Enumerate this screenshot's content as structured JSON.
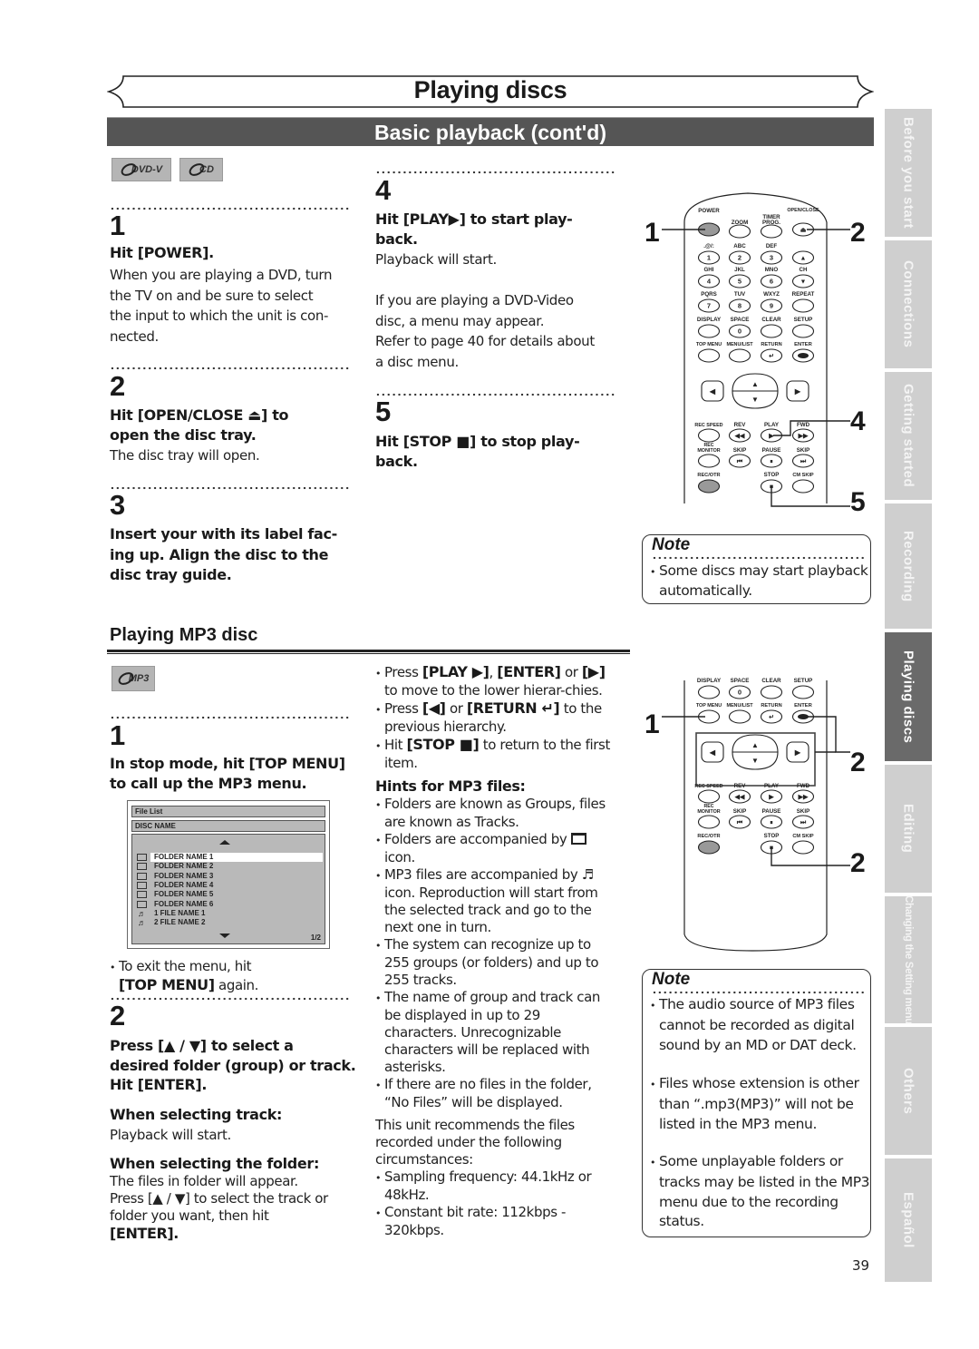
{
  "header": {
    "title": "Playing discs",
    "section": "Basic playback (cont'd)"
  },
  "side_tabs": [
    {
      "label": "Before you start",
      "active": false
    },
    {
      "label": "Connections",
      "active": false
    },
    {
      "label": "Getting started",
      "active": false
    },
    {
      "label": "Recording",
      "active": false
    },
    {
      "label": "Playing discs",
      "active": true
    },
    {
      "label": "Editing",
      "active": false
    },
    {
      "label": "Changing the Setting menu",
      "active": false
    },
    {
      "label": "Others",
      "active": false
    },
    {
      "label": "Español",
      "active": false
    }
  ],
  "badges": {
    "dvd": "DVD-V",
    "cd": "CD",
    "mp3": "MP3"
  },
  "basic": {
    "steps": [
      {
        "num": "1",
        "heading": "Hit [POWER].",
        "body": [
          "When you are playing a DVD, turn",
          "the TV on and be sure to select",
          "the input to which the unit is con-",
          "nected."
        ]
      },
      {
        "num": "2",
        "heading": [
          "Hit [OPEN/CLOSE ⏏] to",
          "open the disc tray."
        ],
        "body": [
          "The disc tray will open."
        ]
      },
      {
        "num": "3",
        "heading": [
          "Insert your with its label fac-",
          "ing up. Align the disc to the",
          "disc tray guide."
        ]
      },
      {
        "num": "4",
        "heading": [
          "Hit [PLAY▶] to start play-",
          "back."
        ],
        "body": [
          "Playback will start.",
          "",
          "If you are playing a DVD-Video",
          "disc, a menu may appear.",
          "Refer to page 40 for details about",
          "a disc menu."
        ]
      },
      {
        "num": "5",
        "heading": [
          "Hit [STOP ■] to stop play-",
          "back."
        ]
      }
    ],
    "note": {
      "title": "Note",
      "items": [
        "Some discs may start playback automatically."
      ]
    },
    "callouts": [
      "1",
      "2",
      "4",
      "5"
    ]
  },
  "mp3": {
    "title": "Playing MP3 disc",
    "step1": {
      "num": "1",
      "heading": [
        "In stop mode, hit [TOP MENU]",
        "to call up the MP3 menu."
      ],
      "exit_text": "To exit the menu, hit",
      "exit_bold": "[TOP MENU]",
      "exit_tail": " again."
    },
    "screen": {
      "header1": "File List",
      "header2": "DISC NAME",
      "items": [
        {
          "type": "folder",
          "label": "FOLDER NAME 1",
          "selected": true
        },
        {
          "type": "folder",
          "label": "FOLDER NAME 2",
          "selected": false
        },
        {
          "type": "folder",
          "label": "FOLDER NAME 3",
          "selected": false
        },
        {
          "type": "folder",
          "label": "FOLDER NAME 4",
          "selected": false
        },
        {
          "type": "folder",
          "label": "FOLDER NAME 5",
          "selected": false
        },
        {
          "type": "folder",
          "label": "FOLDER NAME 6",
          "selected": false
        },
        {
          "type": "file",
          "label": "1 FILE NAME 1",
          "selected": false
        },
        {
          "type": "file",
          "label": "2 FILE NAME 2",
          "selected": false
        }
      ],
      "page": "1/2"
    },
    "step2": {
      "num": "2",
      "heading": [
        "Press [▲ / ▼] to select a",
        "desired folder (group) or track.",
        "Hit [ENTER]."
      ],
      "track_heading": "When selecting track:",
      "track_body": "Playback will start.",
      "folder_heading": "When selecting the folder:",
      "folder_body": [
        "The files in folder will appear.",
        "Press [▲ / ▼] to select the track or",
        "folder you want, then hit"
      ],
      "folder_enter": "[ENTER]."
    },
    "middle": {
      "bullets_top": [
        {
          "html_parts": [
            "Press ",
            "[PLAY ▶]",
            ", ",
            "[ENTER]",
            " or ",
            "[▶]",
            " to move to the lower hierar-chies."
          ]
        },
        {
          "html_parts": [
            "Press ",
            "[◀]",
            " or ",
            "[RETURN ↵]",
            " to the previous hierarchy."
          ]
        },
        {
          "html_parts": [
            "Hit ",
            "[STOP ■]",
            " to return to the first item."
          ]
        }
      ],
      "hints_title": "Hints for MP3 files:",
      "hints": [
        "Folders are known as Groups, files are known as Tracks.",
        "Folders are accompanied by [folder] icon.",
        "MP3 files are accompanied by ♬ icon. Reproduction will start from the selected track and go to the next one in turn.",
        "The system can recognize up to 255 groups (or folders) and up to 255 tracks.",
        "The name of group and track can be displayed in up to 29 characters. Unrecognizable characters will be replaced with asterisks.",
        "If there are no files in the folder, “No Files” will be displayed."
      ],
      "recommend": "This unit recommends the files recorded under the following circumstances:",
      "specs": [
        "Sampling frequency: 44.1kHz or 48kHz.",
        "Constant bit rate: 112kbps - 320kbps."
      ]
    },
    "note": {
      "title": "Note",
      "items": [
        "The audio source of MP3 files cannot be recorded as digital sound by an MD or DAT deck.",
        "Files whose extension is other than “.mp3(MP3)” will not be listed in the MP3 menu.",
        "Some unplayable folders or tracks may be listed in the MP3 menu due to the recording status."
      ]
    },
    "callouts": [
      "1",
      "2",
      "2"
    ]
  },
  "remote_labels": {
    "power": "POWER",
    "zoom": "ZOOM",
    "timer": "TIMER",
    "prog": "PROG.",
    "openclose": "OPEN/CLOSE",
    "k1": ".@/:",
    "k2": "ABC",
    "k3": "DEF",
    "ghi": "GHI",
    "jkl": "JKL",
    "mno": "MNO",
    "ch": "CH",
    "pqrs": "PQRS",
    "tuv": "TUV",
    "wxyz": "WXYZ",
    "repeat": "REPEAT",
    "display": "DISPLAY",
    "space": "SPACE",
    "clear": "CLEAR",
    "setup": "SETUP",
    "topmenu": "TOP MENU",
    "menulist": "MENU/LIST",
    "return": "RETURN",
    "enter": "ENTER",
    "recspeed": "REC SPEED",
    "rev": "REV",
    "play": "PLAY",
    "fwd": "FWD",
    "rec": "REC",
    "monitor": "MONITOR",
    "skip": "SKIP",
    "pause": "PAUSE",
    "recotr": "REC/OTR",
    "stop": "STOP",
    "cmskip": "CM SKIP",
    "n1": "1",
    "n2": "2",
    "n3": "3",
    "n4": "4",
    "n5": "5",
    "n6": "6",
    "n7": "7",
    "n8": "8",
    "n9": "9",
    "n0": "0"
  },
  "page_number": "39"
}
